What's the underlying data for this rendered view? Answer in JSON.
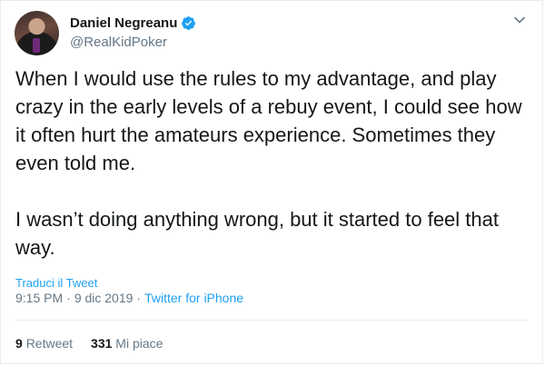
{
  "tweet": {
    "display_name": "Daniel Negreanu",
    "handle": "@RealKidPoker",
    "verified": true,
    "text": "When I would use the rules to my advantage, and play crazy in the early levels of a rebuy event, I could see how it often hurt the amateurs experience. Sometimes they even told me.\n\nI wasn’t doing anything wrong, but it started to feel that way.",
    "translate_label": "Traduci il Tweet",
    "time": "9:15 PM",
    "separator": "·",
    "date": "9 dic 2019",
    "source": "Twitter for iPhone"
  },
  "stats": {
    "retweets_count": "9",
    "retweets_label": "Retweet",
    "likes_count": "331",
    "likes_label": "Mi piace"
  },
  "colors": {
    "text": "#14171a",
    "secondary": "#657786",
    "link": "#1da1f2",
    "verified_badge": "#1da1f2",
    "divider": "#e6ecf0"
  },
  "icons": {
    "verified": "verified-badge-icon",
    "caret": "chevron-down-icon"
  }
}
